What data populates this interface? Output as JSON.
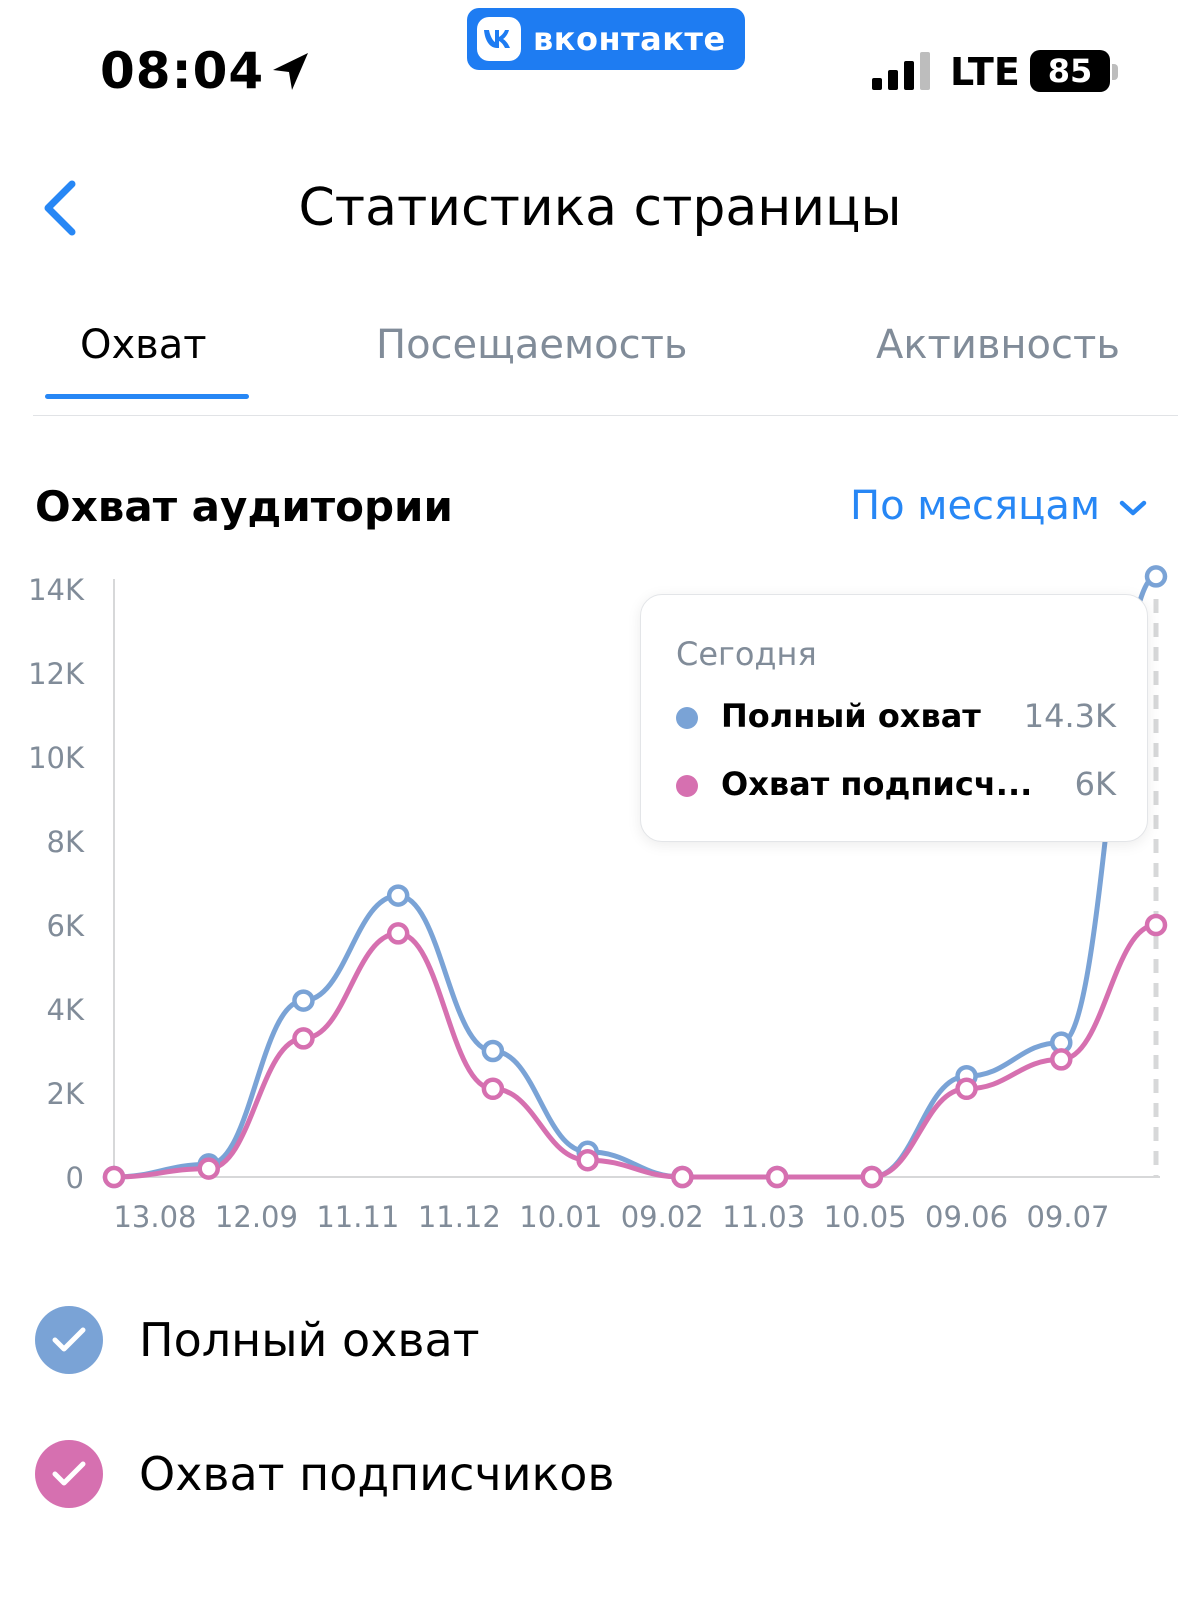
{
  "status_bar": {
    "time": "08:04",
    "app_badge": "вконтакте",
    "network": "LTE",
    "battery": "85"
  },
  "header": {
    "title": "Статистика страницы"
  },
  "tabs": [
    {
      "label": "Охват",
      "active": true
    },
    {
      "label": "Посещаемость",
      "active": false
    },
    {
      "label": "Активность",
      "active": false
    }
  ],
  "section": {
    "title": "Охват аудитории",
    "period": "По месяцам"
  },
  "tooltip": {
    "title": "Сегодня",
    "rows": [
      {
        "name": "Полный охват",
        "value": "14.3K"
      },
      {
        "name": "Охват подписч...",
        "value": "6K"
      }
    ]
  },
  "legend": [
    {
      "label": "Полный охват"
    },
    {
      "label": "Охват подписчиков"
    }
  ],
  "colors": {
    "accent": "#2787f5",
    "full_reach": "#7aa3d6",
    "subscribers": "#d670b0",
    "tick_text": "#818c99"
  },
  "icons": [
    "location-arrow-icon",
    "vk-logo-icon",
    "signal-icon",
    "back-chevron-icon",
    "chevron-down-icon",
    "check-icon"
  ],
  "chart_data": {
    "type": "line",
    "x": [
      "13.08",
      "12.09",
      "11.11",
      "11.12",
      "10.01",
      "09.02",
      "11.03",
      "10.05",
      "09.06",
      "09.07"
    ],
    "x_tick_labels": [
      "13.08",
      "12.09",
      "11.11",
      "11.12",
      "10.01",
      "09.02",
      "11.03",
      "10.05",
      "09.06",
      "09.07"
    ],
    "y_tick_labels": [
      "0",
      "2K",
      "4K",
      "6K",
      "8K",
      "10K",
      "12K",
      "14K"
    ],
    "y_ticks": [
      0,
      2000,
      4000,
      6000,
      8000,
      10000,
      12000,
      14000
    ],
    "ylim": [
      0,
      14000
    ],
    "point_count": 12,
    "series": [
      {
        "name": "Полный охват",
        "color": "#7aa3d6",
        "values": [
          0,
          300,
          4200,
          6700,
          3000,
          600,
          0,
          0,
          0,
          2400,
          3200,
          14300
        ]
      },
      {
        "name": "Охват подписчиков",
        "color": "#d670b0",
        "values": [
          0,
          200,
          3300,
          5800,
          2100,
          400,
          0,
          0,
          0,
          2100,
          2800,
          6000
        ]
      }
    ],
    "selected_index": 11,
    "grid": false,
    "legend_position": "bottom"
  }
}
